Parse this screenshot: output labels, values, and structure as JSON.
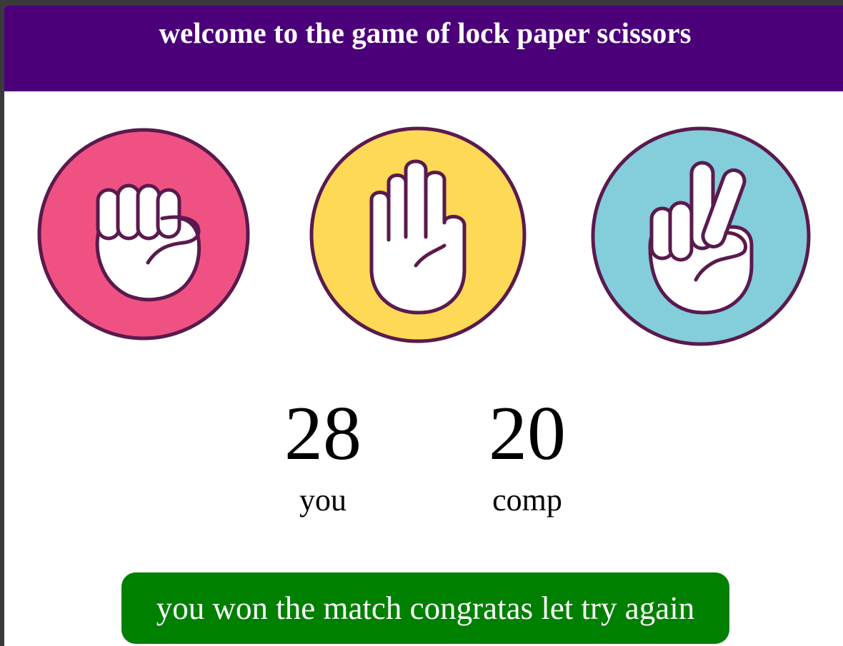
{
  "header": {
    "title": "welcome to the game of lock paper scissors",
    "background_color": "#4b0079"
  },
  "choices": [
    {
      "id": "rock",
      "icon": "rock-fist-icon",
      "color": "#ef5282"
    },
    {
      "id": "paper",
      "icon": "paper-open-hand-icon",
      "color": "#fdd955"
    },
    {
      "id": "scissors",
      "icon": "scissors-two-fingers-icon",
      "color": "#84cddb"
    }
  ],
  "outline_color": "#5a1a4e",
  "scoreboard": {
    "user_score": "28",
    "user_label": "you",
    "comp_score": "20",
    "comp_label": "comp"
  },
  "message": {
    "text": "you won the match congratas let try again",
    "background_color": "#008000"
  }
}
